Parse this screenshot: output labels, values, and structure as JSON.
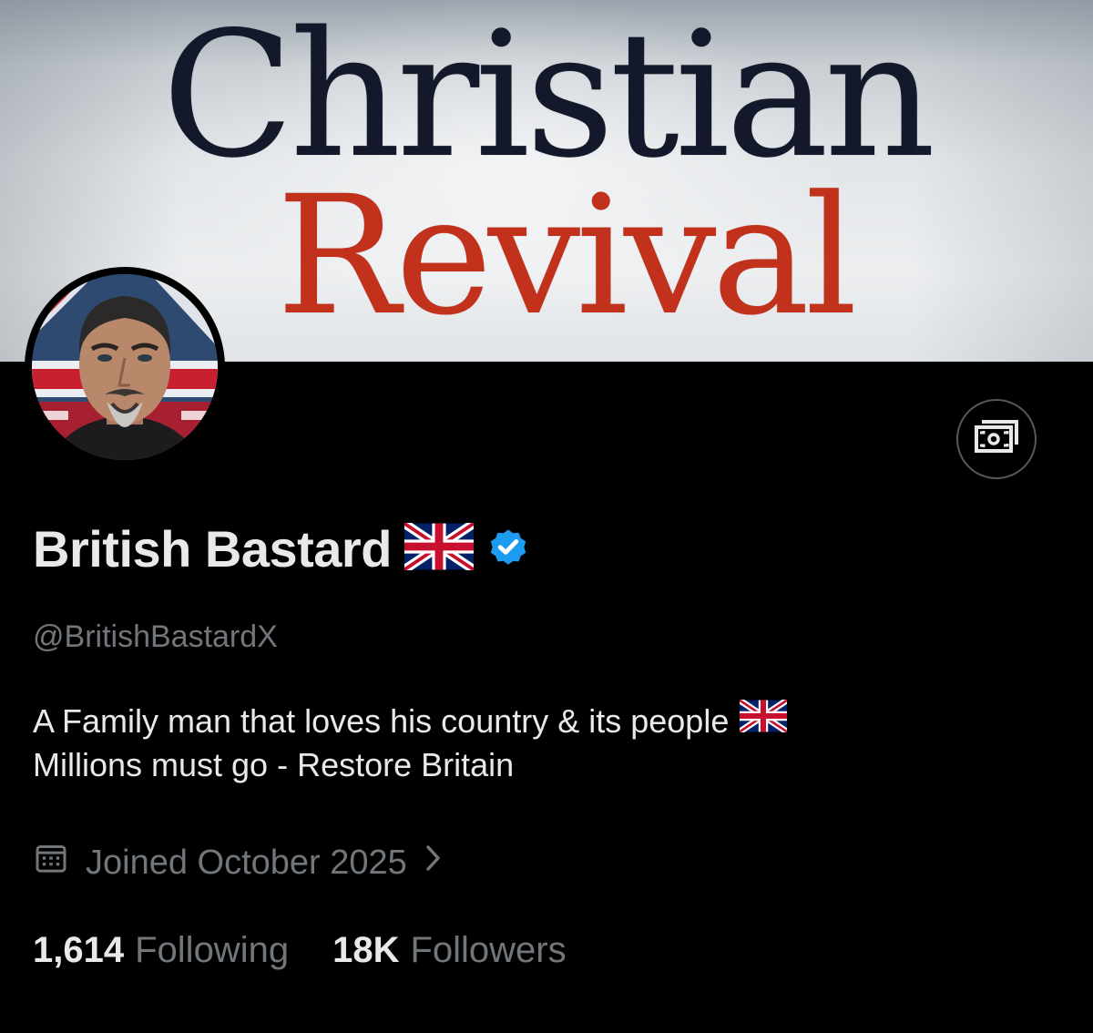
{
  "banner": {
    "line1": "Christian",
    "line2": "Revival"
  },
  "profile": {
    "display_name": "British Bastard",
    "flag_icon": "uk-flag-icon",
    "verified_icon": "verified-badge-icon",
    "verified_color": "#1d9bf0",
    "handle": "@BritishBastardX",
    "bio_line1": "A Family man that loves his country & its people",
    "bio_line2": "Millions must go - Restore Britain",
    "joined": "Joined October 2025",
    "joined_icon": "calendar-icon"
  },
  "stats": {
    "following_count": "1,614",
    "following_label": "Following",
    "followers_count": "18K",
    "followers_label": "Followers"
  },
  "actions": {
    "money_icon": "money-icon"
  }
}
